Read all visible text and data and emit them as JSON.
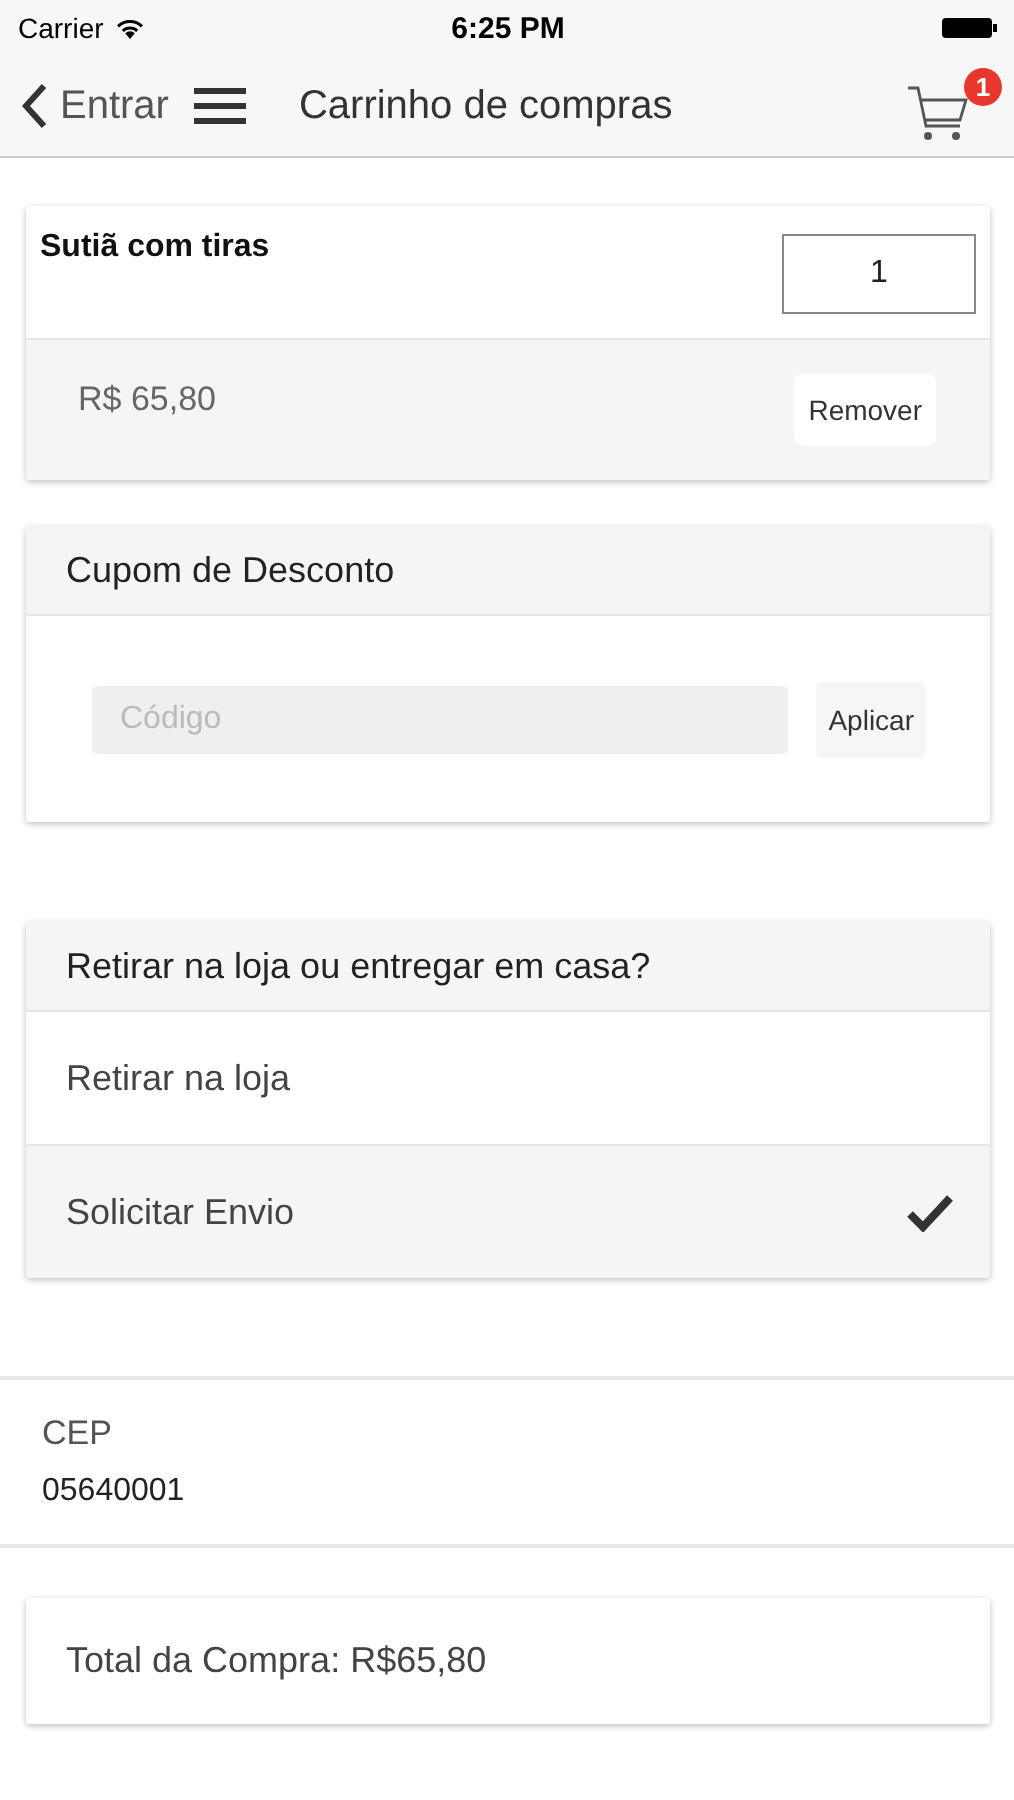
{
  "status_bar": {
    "carrier": "Carrier",
    "time": "6:25 PM"
  },
  "nav": {
    "back_label": "Entrar",
    "title": "Carrinho de compras",
    "cart_badge": "1"
  },
  "cart_items": [
    {
      "name": "Sutiã com tiras",
      "quantity": "1",
      "price": "R$ 65,80",
      "remove_label": "Remover"
    }
  ],
  "coupon": {
    "title": "Cupom de Desconto",
    "placeholder": "Código",
    "apply_label": "Aplicar"
  },
  "delivery": {
    "title": "Retirar na loja ou entregar em casa?",
    "options": [
      {
        "label": "Retirar na loja",
        "selected": false
      },
      {
        "label": "Solicitar Envio",
        "selected": true
      }
    ]
  },
  "cep": {
    "label": "CEP",
    "value": "05640001"
  },
  "total": "Total da Compra: R$65,80"
}
